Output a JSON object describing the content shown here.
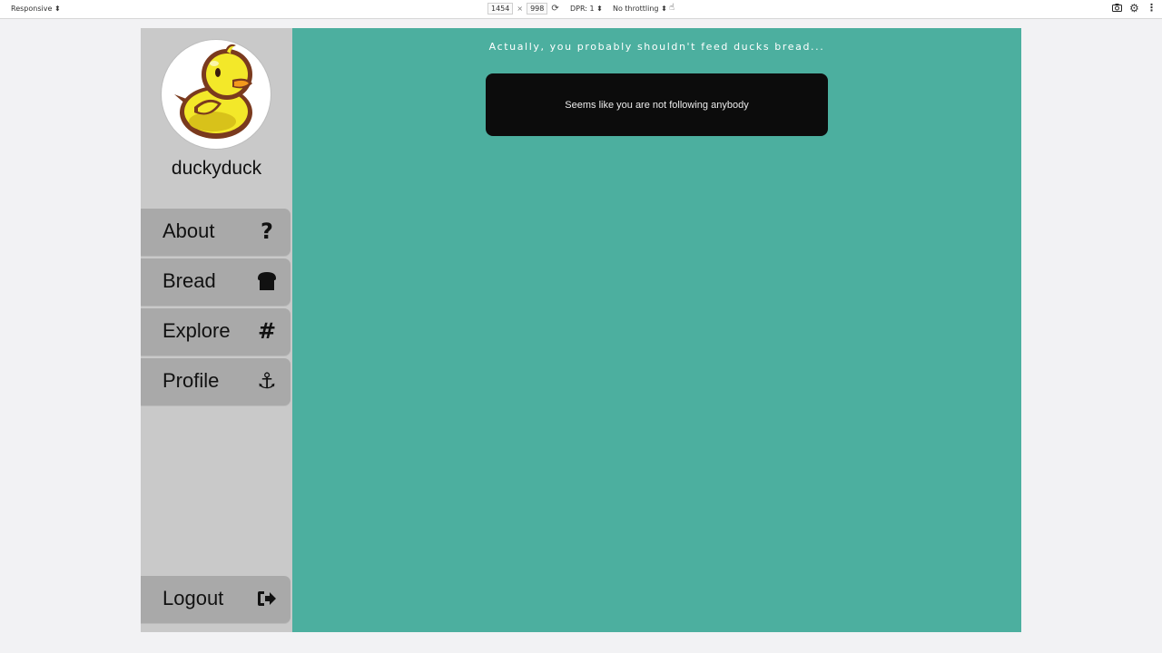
{
  "devtools": {
    "device": "Responsive",
    "width": "1454",
    "times": "×",
    "height": "998",
    "dpr": "DPR: 1",
    "throttle": "No throttling"
  },
  "user": {
    "username": "duckyduck"
  },
  "nav": {
    "items": [
      {
        "label": "About",
        "icon": "question-mark-icon"
      },
      {
        "label": "Bread",
        "icon": "bread-icon"
      },
      {
        "label": "Explore",
        "icon": "hashtag-icon"
      },
      {
        "label": "Profile",
        "icon": "anchor-icon"
      }
    ],
    "logout": {
      "label": "Logout",
      "icon": "logout-icon"
    }
  },
  "main": {
    "header": "Actually, you probably shouldn't feed ducks bread...",
    "empty_message": "Seems like you are not following anybody"
  },
  "colors": {
    "main_bg": "#4caf9f",
    "sidebar_bg": "#c9c9c9",
    "nav_item_bg": "#a9a9a9",
    "notice_bg": "#0c0c0c"
  }
}
